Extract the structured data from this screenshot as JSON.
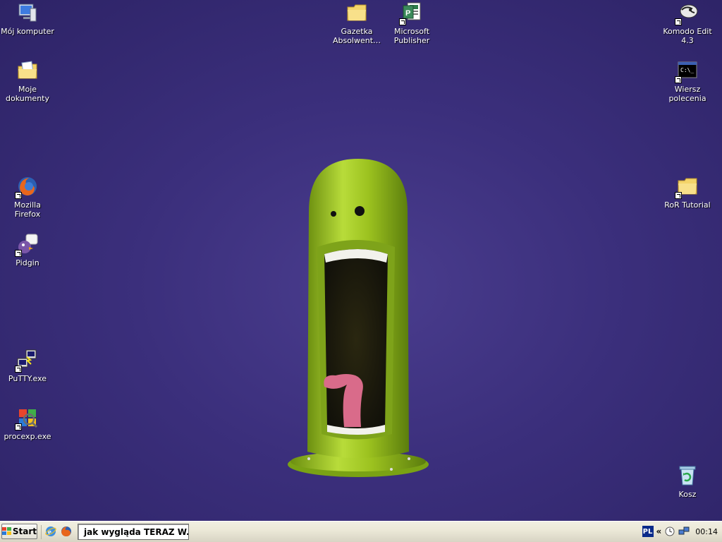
{
  "desktop": {
    "icons_left": [
      {
        "id": "my-computer",
        "label": "Mój komputer",
        "icon": "computer-icon"
      },
      {
        "id": "my-documents",
        "label": "Moje dokumenty",
        "icon": "documents-folder-icon"
      },
      {
        "id": "firefox",
        "label": "Mozilla Firefox",
        "icon": "firefox-icon"
      },
      {
        "id": "pidgin",
        "label": "Pidgin",
        "icon": "pidgin-icon"
      },
      {
        "id": "putty",
        "label": "PuTTY.exe",
        "icon": "putty-icon"
      },
      {
        "id": "procexp",
        "label": "procexp.exe",
        "icon": "procexp-icon"
      }
    ],
    "icons_center": [
      {
        "id": "gazetka",
        "label": "Gazetka Absolwent…",
        "icon": "folder-icon"
      },
      {
        "id": "publisher",
        "label": "Microsoft Publisher",
        "icon": "publisher-icon"
      }
    ],
    "icons_right": [
      {
        "id": "komodo",
        "label": "Komodo Edit 4.3",
        "icon": "komodo-icon"
      },
      {
        "id": "cmd",
        "label": "Wiersz polecenia",
        "icon": "cmd-icon"
      },
      {
        "id": "ror",
        "label": "RoR Tutorial",
        "icon": "folder-icon"
      },
      {
        "id": "recycle",
        "label": "Kosz",
        "icon": "recycle-bin-icon"
      }
    ]
  },
  "taskbar": {
    "start_label": "Start",
    "task_title": "jak wygląda TERAZ W...",
    "language": "PL",
    "tray_expand": "«",
    "clock": "00:14"
  },
  "colors": {
    "desktop_bg": "#3b2f7c",
    "creature_green": "#9cc21f",
    "taskbar_bg": "#ece9d8"
  }
}
